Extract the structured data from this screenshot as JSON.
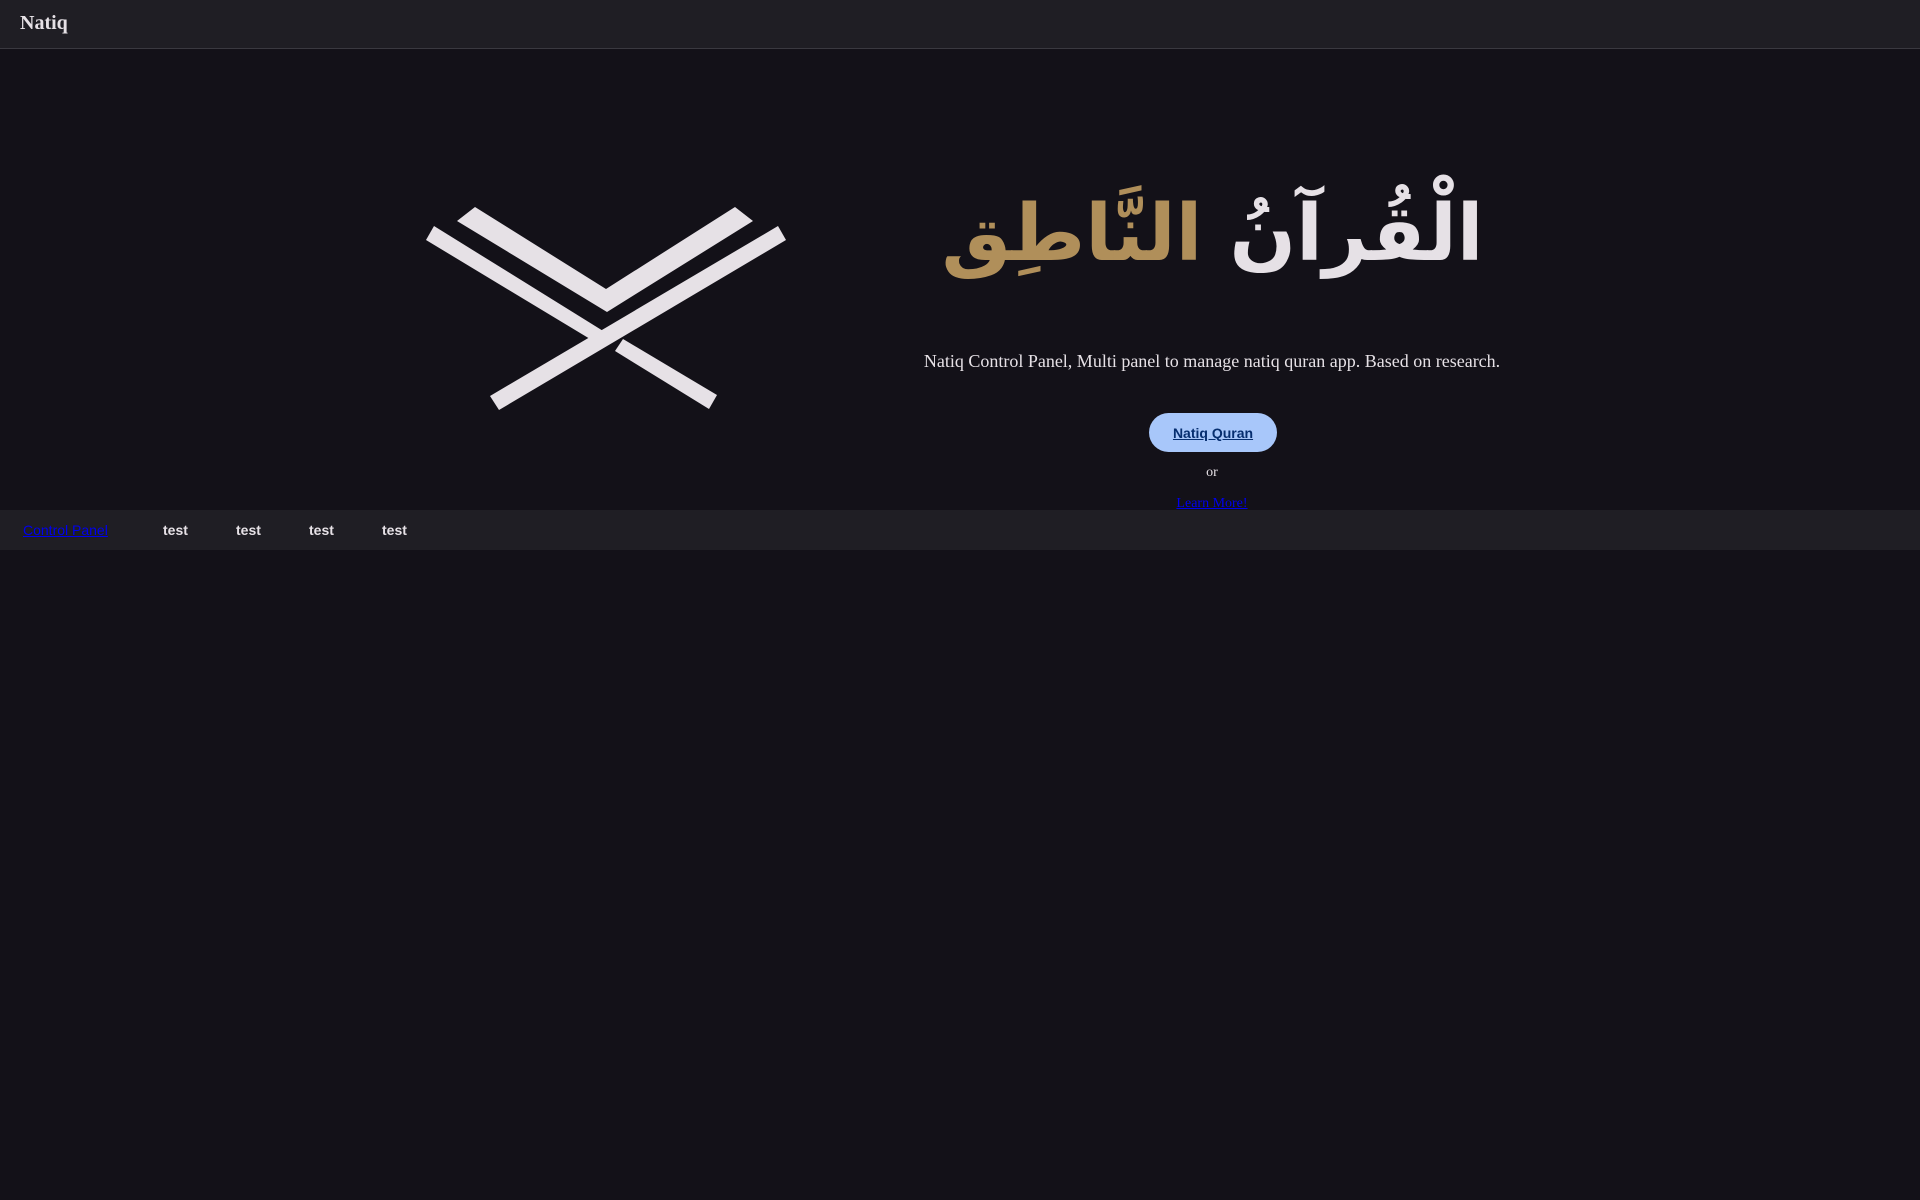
{
  "header": {
    "brand": "Natiq"
  },
  "hero": {
    "title_word_1": "الْقُرآنُ",
    "title_word_2": "النَّاطِق",
    "tagline": "Natiq Control Panel, Multi panel to manage natiq quran app. Based on research.",
    "cta_label": "Natiq Quran",
    "separator": "or",
    "learn_more": "Learn More!",
    "logo_icon": "quran-book-icon",
    "colors": {
      "title_primary": "#e6e1e6",
      "title_accent": "#b08f5a",
      "button_bg": "#a8c7fa",
      "button_text": "#062e6f"
    }
  },
  "footer_nav": {
    "items": [
      {
        "label": "Control Panel"
      },
      {
        "label": "test"
      },
      {
        "label": "test"
      },
      {
        "label": "test"
      },
      {
        "label": "test"
      }
    ]
  }
}
